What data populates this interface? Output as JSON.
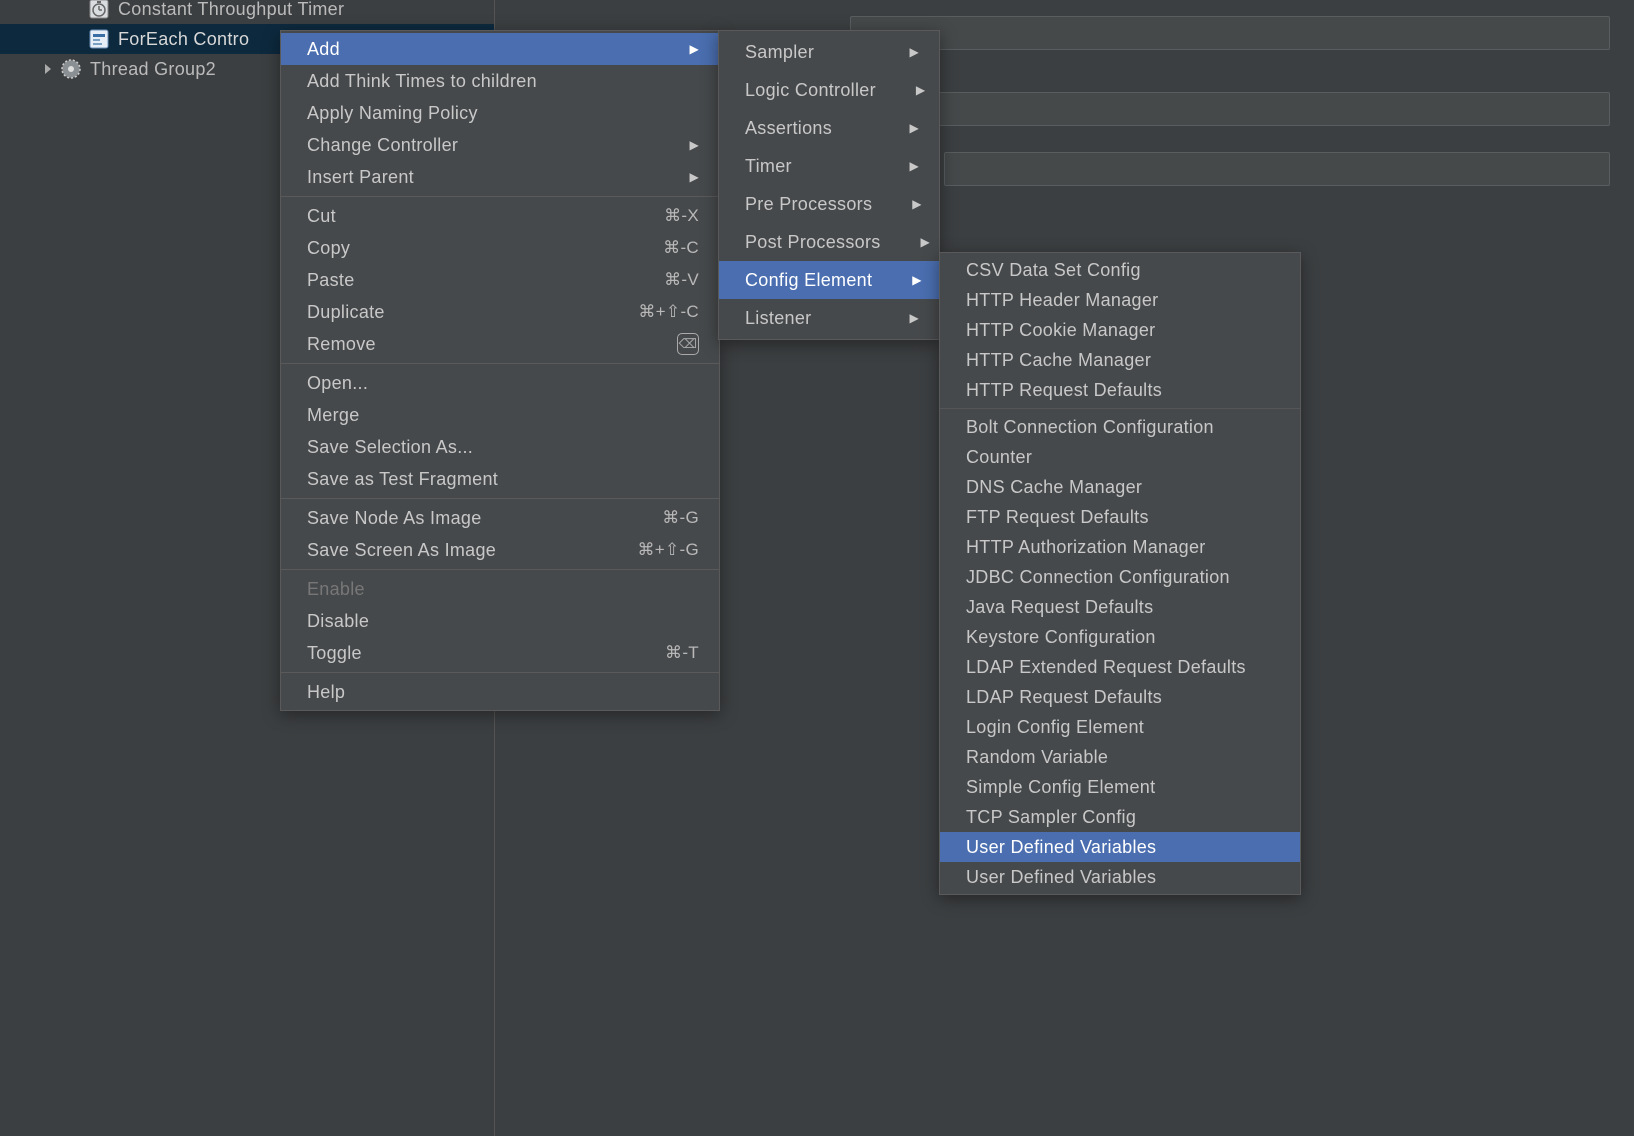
{
  "tree": {
    "item_timer": "Constant Throughput Timer",
    "item_foreach": "ForEach Contro",
    "item_group2": "Thread Group2"
  },
  "menu_main": {
    "add": "Add",
    "add_think": "Add Think Times to children",
    "apply_naming": "Apply Naming Policy",
    "change_ctrl": "Change Controller",
    "insert_parent": "Insert Parent",
    "cut": "Cut",
    "cut_sc": "⌘-X",
    "copy": "Copy",
    "copy_sc": "⌘-C",
    "paste": "Paste",
    "paste_sc": "⌘-V",
    "duplicate": "Duplicate",
    "duplicate_sc": "⌘+⇧-C",
    "remove": "Remove",
    "open": "Open...",
    "merge": "Merge",
    "save_sel": "Save Selection As...",
    "save_frag": "Save as Test Fragment",
    "save_node_img": "Save Node As Image",
    "save_node_img_sc": "⌘-G",
    "save_screen_img": "Save Screen As Image",
    "save_screen_img_sc": "⌘+⇧-G",
    "enable": "Enable",
    "disable": "Disable",
    "toggle": "Toggle",
    "toggle_sc": "⌘-T",
    "help": "Help"
  },
  "menu_add": {
    "sampler": "Sampler",
    "logic": "Logic Controller",
    "assertions": "Assertions",
    "timer": "Timer",
    "pre": "Pre Processors",
    "post": "Post Processors",
    "config": "Config Element",
    "listener": "Listener"
  },
  "menu_config": {
    "csv": "CSV Data Set Config",
    "http_header": "HTTP Header Manager",
    "http_cookie": "HTTP Cookie Manager",
    "http_cache": "HTTP Cache Manager",
    "http_req_def": "HTTP Request Defaults",
    "bolt": "Bolt Connection Configuration",
    "counter": "Counter",
    "dns": "DNS Cache Manager",
    "ftp": "FTP Request Defaults",
    "http_auth": "HTTP Authorization Manager",
    "jdbc": "JDBC Connection Configuration",
    "java_req": "Java Request Defaults",
    "keystore": "Keystore Configuration",
    "ldap_ext": "LDAP Extended Request Defaults",
    "ldap_req": "LDAP Request Defaults",
    "login": "Login Config Element",
    "random": "Random Variable",
    "simple": "Simple Config Element",
    "tcp": "TCP Sampler Config",
    "udv1": "User Defined Variables",
    "udv2": "User Defined Variables"
  }
}
